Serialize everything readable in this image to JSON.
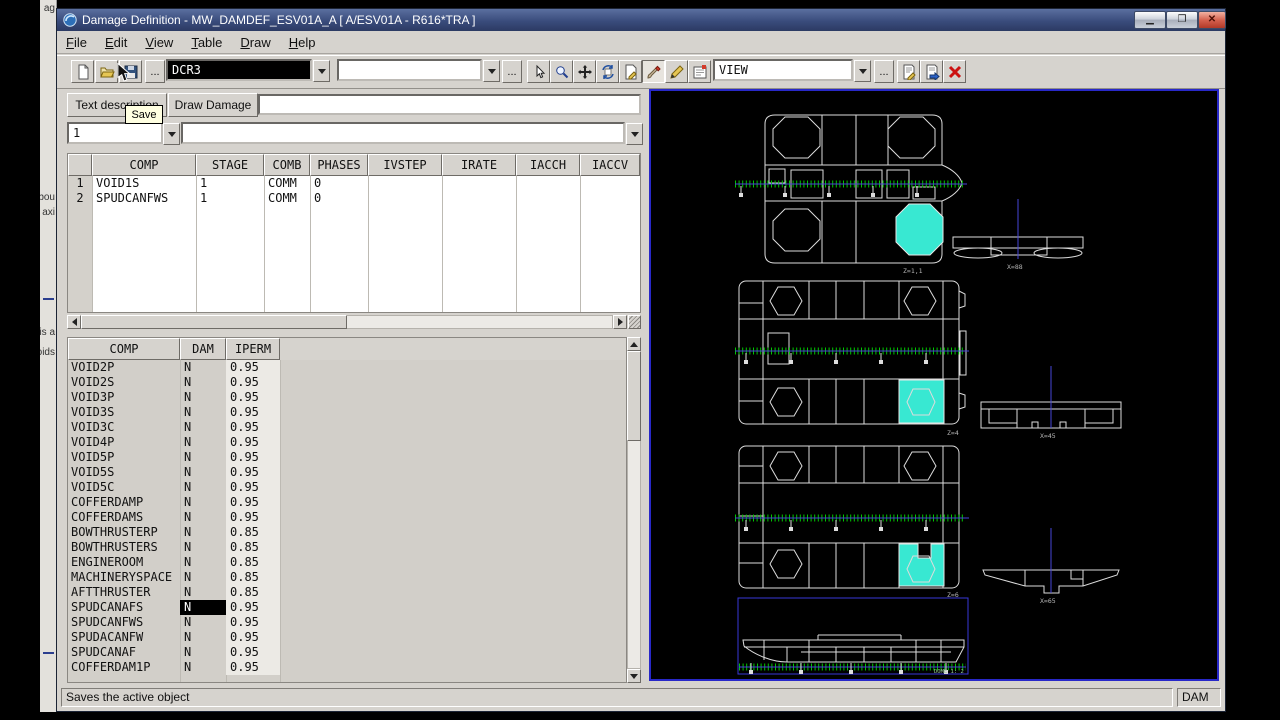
{
  "window": {
    "title": "Damage Definition - MW_DAMDEF_ESV01A_A [ A/ESV01A - R616*TRA ]"
  },
  "menu": {
    "items": [
      "File",
      "Edit",
      "View",
      "Table",
      "Draw",
      "Help"
    ]
  },
  "toolbar": {
    "ellipsis": "...",
    "damage_case_combo": "DCR3",
    "secondary_combo": "",
    "view_combo": "VIEW"
  },
  "tabs": {
    "text_description": "Text description",
    "draw_damage": "Draw Damage",
    "description_field": ""
  },
  "tooltip": {
    "save": "Save"
  },
  "stage_row": {
    "stage_combo": "1",
    "damage_combo": ""
  },
  "upper_table": {
    "columns": [
      "",
      "COMP",
      "STAGE",
      "COMB",
      "PHASES",
      "IVSTEP",
      "IRATE",
      "IACCH",
      "IACCV"
    ],
    "rows": [
      [
        "1",
        "VOID1S",
        "1",
        "COMM",
        "0"
      ],
      [
        "2",
        "SPUDCANFWS",
        "1",
        "COMM",
        "0"
      ]
    ]
  },
  "lower_table": {
    "columns": [
      "COMP",
      "DAM",
      "IPERM"
    ],
    "selected_comp": "SPUDCANAFS",
    "rows": [
      [
        "VOID2P",
        "N",
        "0.95"
      ],
      [
        "VOID2S",
        "N",
        "0.95"
      ],
      [
        "VOID3P",
        "N",
        "0.95"
      ],
      [
        "VOID3S",
        "N",
        "0.95"
      ],
      [
        "VOID3C",
        "N",
        "0.95"
      ],
      [
        "VOID4P",
        "N",
        "0.95"
      ],
      [
        "VOID5P",
        "N",
        "0.95"
      ],
      [
        "VOID5S",
        "N",
        "0.95"
      ],
      [
        "VOID5C",
        "N",
        "0.95"
      ],
      [
        "COFFERDAMP",
        "N",
        "0.95"
      ],
      [
        "COFFERDAMS",
        "N",
        "0.95"
      ],
      [
        "BOWTHRUSTERP",
        "N",
        "0.85"
      ],
      [
        "BOWTHRUSTERS",
        "N",
        "0.85"
      ],
      [
        "ENGINEROOM",
        "N",
        "0.85"
      ],
      [
        "MACHINERYSPACE",
        "N",
        "0.85"
      ],
      [
        "AFTTHRUSTER",
        "N",
        "0.85"
      ],
      [
        "SPUDCANAFS",
        "N",
        "0.95"
      ],
      [
        "SPUDCANFWS",
        "N",
        "0.95"
      ],
      [
        "SPUDACANFW",
        "N",
        "0.95"
      ],
      [
        "SPUDCANAF",
        "N",
        "0.95"
      ],
      [
        "COFFERDAM1P",
        "N",
        "0.95"
      ]
    ]
  },
  "statusbar": {
    "message": "Saves the active object",
    "mode": "DAM"
  },
  "drawing": {
    "labels": {
      "plan_top": "Z=1,1",
      "plan_mid": "Z=4",
      "plan_bottom": "Z=6",
      "section_top": "X=88",
      "section_mid": "X=45",
      "section_bottom": "X=65",
      "profile": "DOME 1: 2"
    },
    "colors": {
      "highlight_cyan": "#38E8D2",
      "ruler_green": "#00C800",
      "axis_blue": "#4646D8",
      "panel_border_blue": "#2828C8"
    }
  },
  "background_window": {
    "fragments": [
      "ag",
      "bou",
      "axi",
      "is a",
      "oids"
    ]
  }
}
